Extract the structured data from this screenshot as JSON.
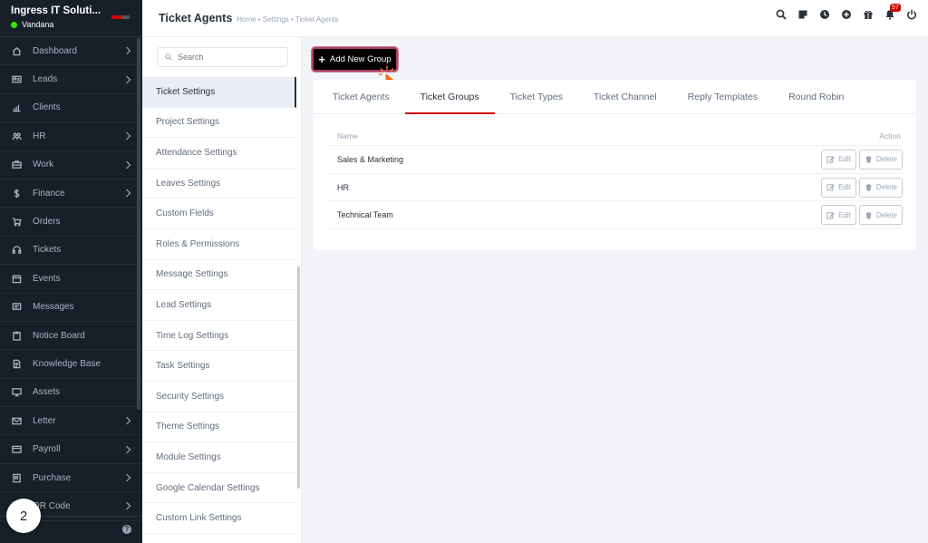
{
  "app": {
    "company": "Ingress IT Soluti...",
    "user": "Vandana"
  },
  "sidebar": {
    "items": [
      {
        "label": "Dashboard",
        "icon": "house-icon",
        "submenu": true
      },
      {
        "label": "Leads",
        "icon": "id-card-icon",
        "submenu": true
      },
      {
        "label": "Clients",
        "icon": "bar-chart-icon",
        "submenu": false
      },
      {
        "label": "HR",
        "icon": "people-icon",
        "submenu": true
      },
      {
        "label": "Work",
        "icon": "briefcase-icon",
        "submenu": true
      },
      {
        "label": "Finance",
        "icon": "dollar-icon",
        "submenu": true
      },
      {
        "label": "Orders",
        "icon": "cart-icon",
        "submenu": false
      },
      {
        "label": "Tickets",
        "icon": "headset-icon",
        "submenu": false
      },
      {
        "label": "Events",
        "icon": "calendar-icon",
        "submenu": false
      },
      {
        "label": "Messages",
        "icon": "chat-icon",
        "submenu": false
      },
      {
        "label": "Notice Board",
        "icon": "clipboard-icon",
        "submenu": false
      },
      {
        "label": "Knowledge Base",
        "icon": "document-icon",
        "submenu": false
      },
      {
        "label": "Assets",
        "icon": "monitor-icon",
        "submenu": false
      },
      {
        "label": "Letter",
        "icon": "envelope-icon",
        "submenu": true
      },
      {
        "label": "Payroll",
        "icon": "wallet-icon",
        "submenu": true
      },
      {
        "label": "Purchase",
        "icon": "purchase-icon",
        "submenu": true
      },
      {
        "label": "QR Code",
        "icon": "qr-icon",
        "submenu": true
      }
    ],
    "step_number": "2",
    "help": "?"
  },
  "header": {
    "title": "Ticket Agents",
    "breadcrumb": "Home • Settings • Ticket Agents",
    "notification_count": "57"
  },
  "settings_menu": {
    "search_placeholder": "Search",
    "items": [
      "Ticket Settings",
      "Project Settings",
      "Attendance Settings",
      "Leaves Settings",
      "Custom Fields",
      "Roles & Permissions",
      "Message Settings",
      "Lead Settings",
      "Time Log Settings",
      "Task Settings",
      "Security Settings",
      "Theme Settings",
      "Module Settings",
      "Google Calendar Settings",
      "Custom Link Settings"
    ],
    "active_index": 0
  },
  "main": {
    "add_button_label": "Add New Group",
    "tabs": [
      "Ticket Agents",
      "Ticket Groups",
      "Ticket Types",
      "Ticket Channel",
      "Reply Templates",
      "Round Robin"
    ],
    "active_tab": 1,
    "table": {
      "col_name": "Name",
      "col_action": "Action",
      "rows": [
        {
          "name": "Sales & Marketing"
        },
        {
          "name": "HR"
        },
        {
          "name": "Technical Team"
        }
      ],
      "edit_label": "Edit",
      "delete_label": "Delete"
    }
  },
  "colors": {
    "sidebar_bg": "#171f29",
    "accent": "#d30000",
    "online": "#39e500"
  }
}
